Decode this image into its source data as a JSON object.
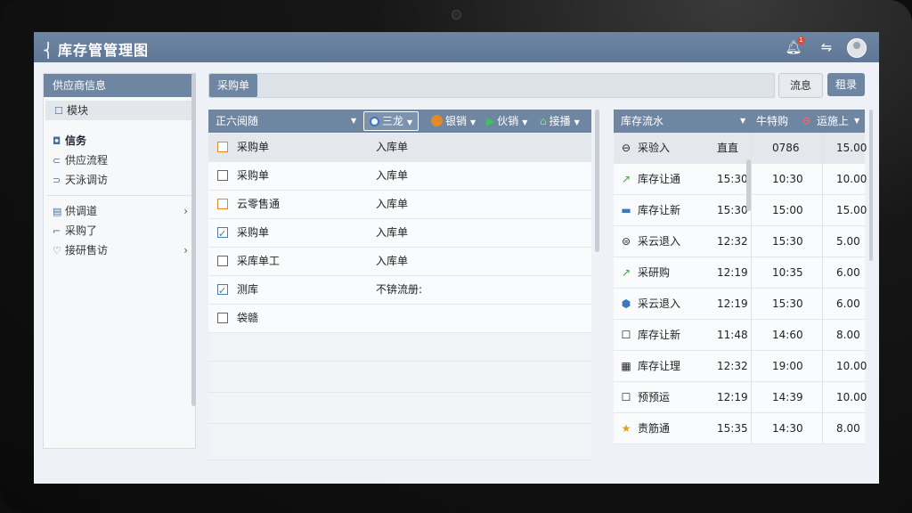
{
  "app": {
    "title": "库存管管理图"
  },
  "topbar": {
    "badge": "1"
  },
  "sidebar": {
    "header": "供应商信息",
    "items": [
      {
        "label": "模块",
        "icon": "☐"
      },
      {
        "label": "信务",
        "icon": "◘"
      },
      {
        "label": "供应流程",
        "icon": "⊂"
      },
      {
        "label": "天泳调访",
        "icon": "⊃"
      },
      {
        "label": "供调道",
        "icon": "▤",
        "chevron": "›"
      },
      {
        "label": "采购了",
        "icon": "⌐"
      },
      {
        "label": "接研售访",
        "icon": "♡",
        "chevron": "›"
      }
    ]
  },
  "breadcrumb": {
    "label": "采购单"
  },
  "buttons": {
    "flow": "流息",
    "search": "租录"
  },
  "toolbar": {
    "col1": "正六阅随",
    "t1": "三龙",
    "t2": "银销",
    "t3": "伙销",
    "t4": "接播"
  },
  "list": {
    "rows": [
      {
        "name": "采购单",
        "type": "入库单",
        "check": "orange"
      },
      {
        "name": "采购单",
        "type": "入库单",
        "check": "plain"
      },
      {
        "name": "云零售通",
        "type": "入库单",
        "check": "orange"
      },
      {
        "name": "采购单",
        "type": "入库单",
        "check": "checked"
      },
      {
        "name": "采库单工",
        "type": "入库单",
        "check": "plain"
      },
      {
        "name": "测库",
        "type": "不锛流册:",
        "check": "checked"
      },
      {
        "name": "袋赣",
        "type": "",
        "check": "plain"
      }
    ]
  },
  "right_table": {
    "headers": {
      "name": "库存流水",
      "c2": "牛特购",
      "c3": "运施上"
    },
    "rows": [
      {
        "icon": "⊖",
        "name": "采验入",
        "time": "直直",
        "num": "0786",
        "val": "15.00"
      },
      {
        "icon": "↗",
        "name": "库存让通",
        "time": "15:30",
        "num": "10:30",
        "val": "10.00"
      },
      {
        "icon": "▬",
        "name": "库存让新",
        "time": "15:30",
        "num": "15:00",
        "val": "15.00"
      },
      {
        "icon": "⊜",
        "name": "采云退入",
        "time": "12:32",
        "num": "15:30",
        "val": "5.00"
      },
      {
        "icon": "↗",
        "name": "采研购",
        "time": "12:19",
        "num": "10:35",
        "val": "6.00"
      },
      {
        "icon": "⬢",
        "name": "采云退入",
        "time": "12:19",
        "num": "15:30",
        "val": "6.00"
      },
      {
        "icon": "☐",
        "name": "库存让新",
        "time": "11:48",
        "num": "14:60",
        "val": "8.00"
      },
      {
        "icon": "▦",
        "name": "库存让理",
        "time": "12:32",
        "num": "19:00",
        "val": "10.00"
      },
      {
        "icon": "☐",
        "name": "预预运",
        "time": "12:19",
        "num": "14:39",
        "val": "10.00"
      },
      {
        "icon": "★",
        "name": "责筋通",
        "time": "15:35",
        "num": "14:30",
        "val": "8.00"
      }
    ]
  },
  "colors": {
    "header": "#6f86a3",
    "accent_orange": "#e08a2a",
    "accent_blue": "#3a78c2"
  }
}
